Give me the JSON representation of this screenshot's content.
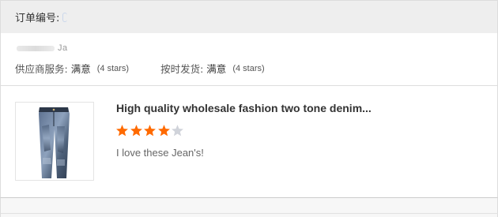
{
  "order": {
    "number_label": "订单编号:"
  },
  "seller_feedback": {
    "buyer_name": "Ja",
    "ratings": [
      {
        "label": "供应商服务:",
        "value": "满意",
        "stars": "(4 stars)"
      },
      {
        "label": "按时发货:",
        "value": "满意",
        "stars": "(4 stars)"
      }
    ]
  },
  "product": {
    "title": "High quality wholesale fashion two tone denim...",
    "rating": 4,
    "max_rating": 5,
    "review": "I love these Jean's!",
    "image_icon": "jeans-product-image"
  },
  "colors": {
    "star_filled": "#ff6a00",
    "star_empty": "#d0d3da",
    "header_bg": "#eeeeee"
  }
}
